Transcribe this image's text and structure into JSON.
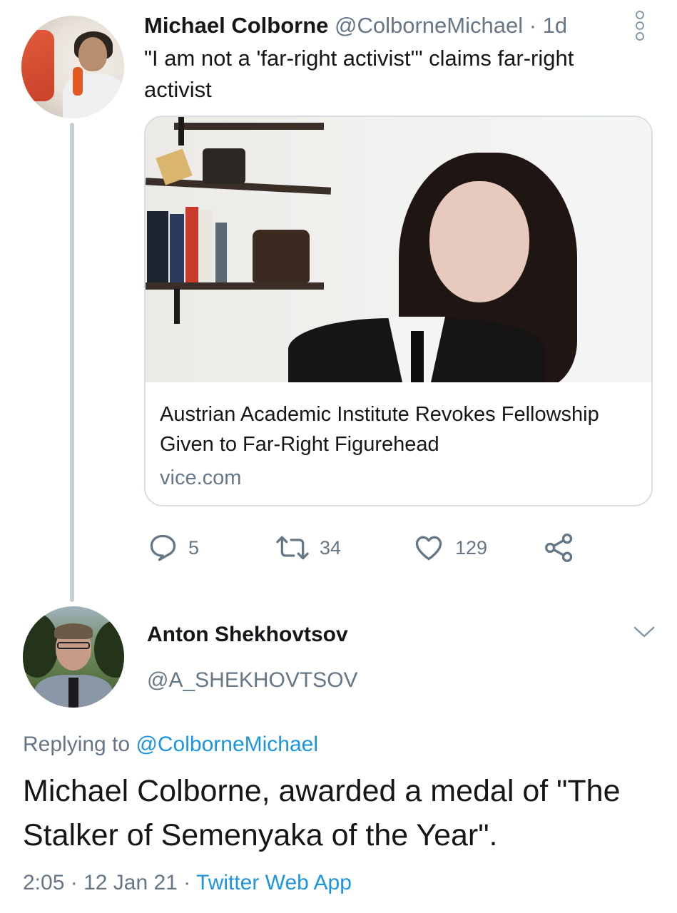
{
  "parent_tweet": {
    "author_name": "Michael Colborne",
    "author_handle": "@ColborneMichael",
    "separator": "·",
    "relative_time": "1d",
    "text": "\"I am not a 'far-right activist'\" claims far-right activist",
    "card": {
      "title": "Austrian Academic Institute Revokes Fellowship Given to Far-Right Figurehead",
      "domain": "vice.com"
    },
    "actions": {
      "reply_count": "5",
      "retweet_count": "34",
      "like_count": "129"
    },
    "icons": {
      "more": "more-vertical-icon",
      "reply": "reply-icon",
      "retweet": "retweet-icon",
      "like": "heart-icon",
      "share": "share-icon"
    }
  },
  "reply_tweet": {
    "author_name": "Anton Shekhovtsov",
    "author_handle": "@A_SHEKHOVTSOV",
    "replying_prefix": "Replying to",
    "replying_handle": "@ColborneMichael",
    "text": "Michael Colborne, awarded a medal of \"The Stalker of Semenyaka of the Year\".",
    "time": "2:05",
    "separator": "·",
    "date": "12 Jan 21",
    "source": "Twitter Web App",
    "icons": {
      "menu": "chevron-down-icon"
    }
  },
  "colors": {
    "text_primary": "#14171a",
    "text_secondary": "#657786",
    "link": "#1b95e0",
    "border": "#d6dde3",
    "thread_line": "#c4cfd6"
  }
}
